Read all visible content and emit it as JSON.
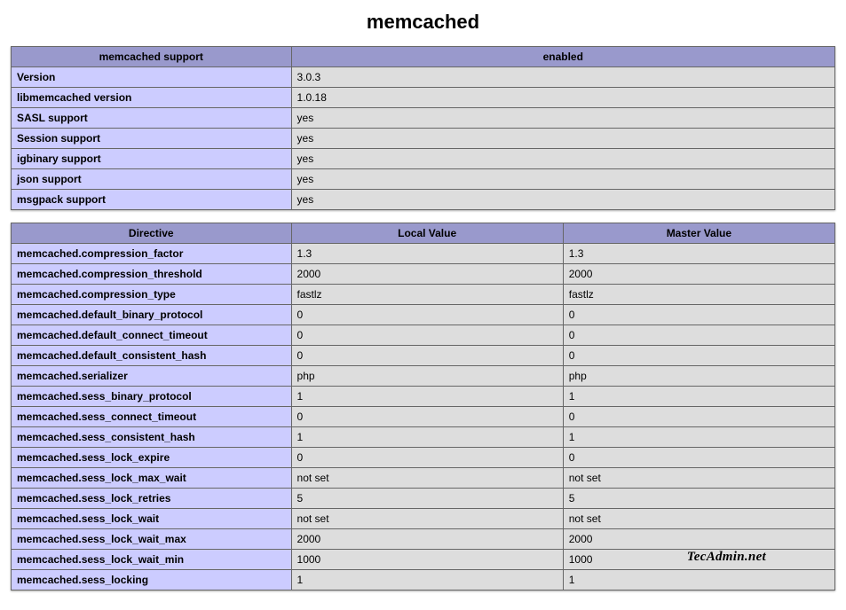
{
  "title": "memcached",
  "support_table": {
    "headers": [
      "memcached support",
      "enabled"
    ],
    "rows": [
      {
        "label": "Version",
        "value": "3.0.3"
      },
      {
        "label": "libmemcached version",
        "value": "1.0.18"
      },
      {
        "label": "SASL support",
        "value": "yes"
      },
      {
        "label": "Session support",
        "value": "yes"
      },
      {
        "label": "igbinary support",
        "value": "yes"
      },
      {
        "label": "json support",
        "value": "yes"
      },
      {
        "label": "msgpack support",
        "value": "yes"
      }
    ]
  },
  "directives_table": {
    "headers": [
      "Directive",
      "Local Value",
      "Master Value"
    ],
    "rows": [
      {
        "directive": "memcached.compression_factor",
        "local": "1.3",
        "master": "1.3"
      },
      {
        "directive": "memcached.compression_threshold",
        "local": "2000",
        "master": "2000"
      },
      {
        "directive": "memcached.compression_type",
        "local": "fastlz",
        "master": "fastlz"
      },
      {
        "directive": "memcached.default_binary_protocol",
        "local": "0",
        "master": "0"
      },
      {
        "directive": "memcached.default_connect_timeout",
        "local": "0",
        "master": "0"
      },
      {
        "directive": "memcached.default_consistent_hash",
        "local": "0",
        "master": "0"
      },
      {
        "directive": "memcached.serializer",
        "local": "php",
        "master": "php"
      },
      {
        "directive": "memcached.sess_binary_protocol",
        "local": "1",
        "master": "1"
      },
      {
        "directive": "memcached.sess_connect_timeout",
        "local": "0",
        "master": "0"
      },
      {
        "directive": "memcached.sess_consistent_hash",
        "local": "1",
        "master": "1"
      },
      {
        "directive": "memcached.sess_lock_expire",
        "local": "0",
        "master": "0"
      },
      {
        "directive": "memcached.sess_lock_max_wait",
        "local": "not set",
        "master": "not set"
      },
      {
        "directive": "memcached.sess_lock_retries",
        "local": "5",
        "master": "5"
      },
      {
        "directive": "memcached.sess_lock_wait",
        "local": "not set",
        "master": "not set"
      },
      {
        "directive": "memcached.sess_lock_wait_max",
        "local": "2000",
        "master": "2000"
      },
      {
        "directive": "memcached.sess_lock_wait_min",
        "local": "1000",
        "master": "1000"
      },
      {
        "directive": "memcached.sess_locking",
        "local": "1",
        "master": "1"
      }
    ]
  },
  "watermark": "TecAdmin.net"
}
